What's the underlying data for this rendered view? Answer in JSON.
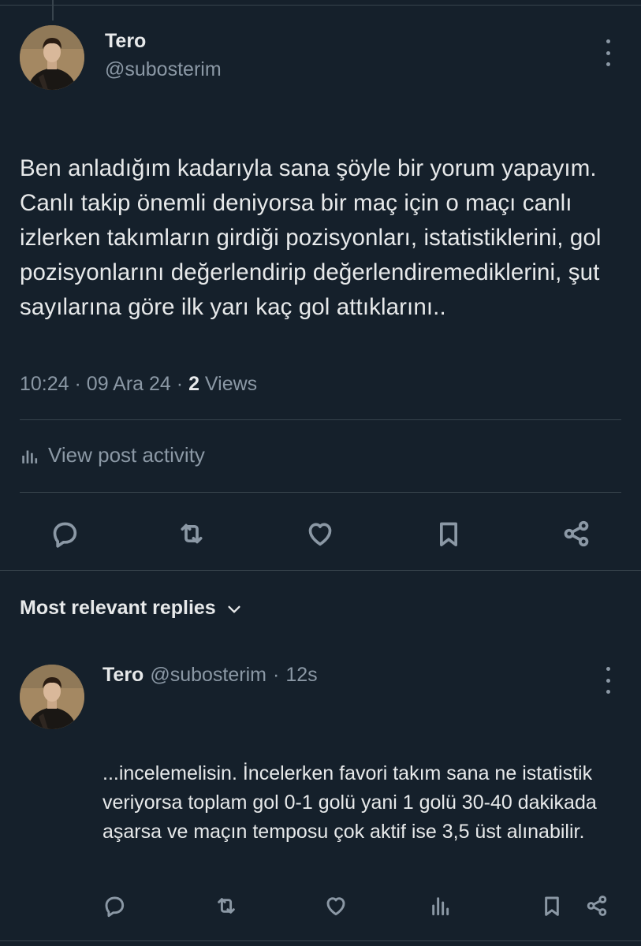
{
  "post": {
    "author_name": "Tero",
    "author_handle": "@subosterim",
    "text": "Ben anladığım kadarıyla sana şöyle bir yorum yapayım. Canlı takip önemli deniyorsa bir maç için o maçı canlı izlerken takımların girdiği pozisyonları, istatistiklerini, gol pozisyonlarını değerlendirip değerlendiremediklerini, şut sayılarına göre ilk yarı kaç gol attıklarını..",
    "time": "10:24",
    "date": "09 Ara 24",
    "separator": "·",
    "views_count": "2",
    "views_label": "Views",
    "activity_label": "View post activity"
  },
  "actions": {
    "reply_icon": "speech-bubble-icon",
    "repost_icon": "repost-icon",
    "like_icon": "heart-icon",
    "bookmark_icon": "bookmark-icon",
    "share_icon": "share-icon"
  },
  "replies": {
    "heading": "Most relevant replies",
    "items": [
      {
        "author_name": "Tero",
        "author_handle": "@subosterim",
        "separator": "·",
        "time": "12s",
        "text": "...incelemelisin. İncelerken favori takım sana ne istatistik veriyorsa toplam gol 0-1 golü yani 1 golü 30-40 dakikada aşarsa ve maçın temposu çok aktif ise 3,5 üst alınabilir."
      }
    ]
  },
  "colors": {
    "background": "#15202b",
    "text_primary": "#e7e9ea",
    "text_secondary": "#8b98a5",
    "border": "#38444d"
  }
}
